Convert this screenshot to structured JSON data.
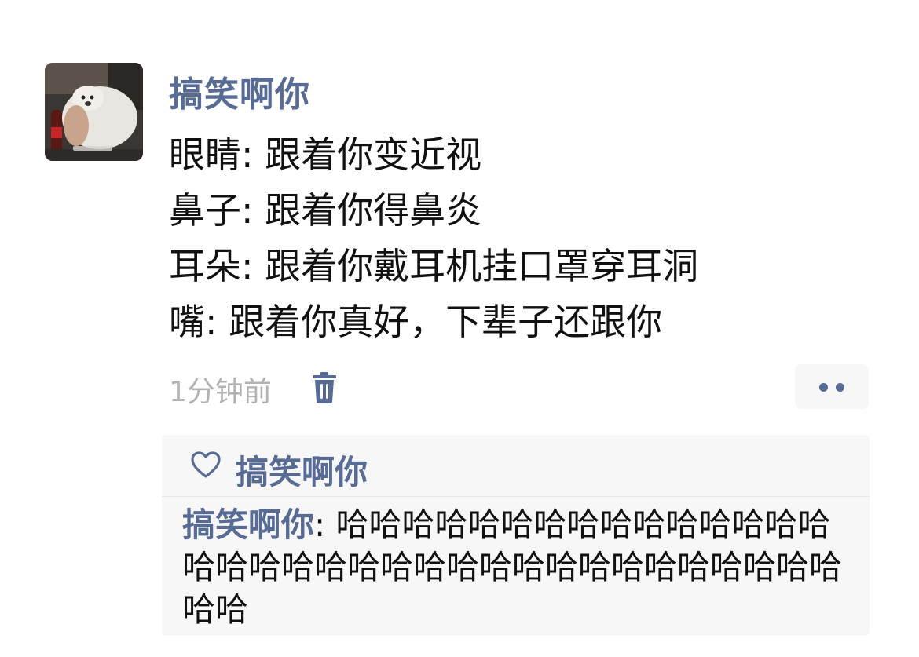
{
  "post": {
    "author": "搞笑啊你",
    "lines": [
      "眼睛: 跟着你变近视",
      "鼻子: 跟着你得鼻炎",
      "耳朵: 跟着你戴耳机挂口罩穿耳洞",
      "嘴: 跟着你真好，下辈子还跟你"
    ],
    "time": "1分钟前",
    "delete_icon": "trash-icon",
    "more_icon": "more-dots-icon"
  },
  "interactions": {
    "like_icon": "heart-outline-icon",
    "likes": [
      "搞笑啊你"
    ],
    "comments": [
      {
        "author": "搞笑啊你",
        "separator": ": ",
        "text": "哈哈哈哈哈哈哈哈哈哈哈哈哈哈哈哈哈哈哈哈哈哈哈哈哈哈哈哈哈哈哈哈哈哈哈哈哈"
      }
    ]
  },
  "colors": {
    "link": "#576b95",
    "text": "#111111",
    "muted": "#b2b2b2",
    "panel": "#f7f7f7"
  }
}
